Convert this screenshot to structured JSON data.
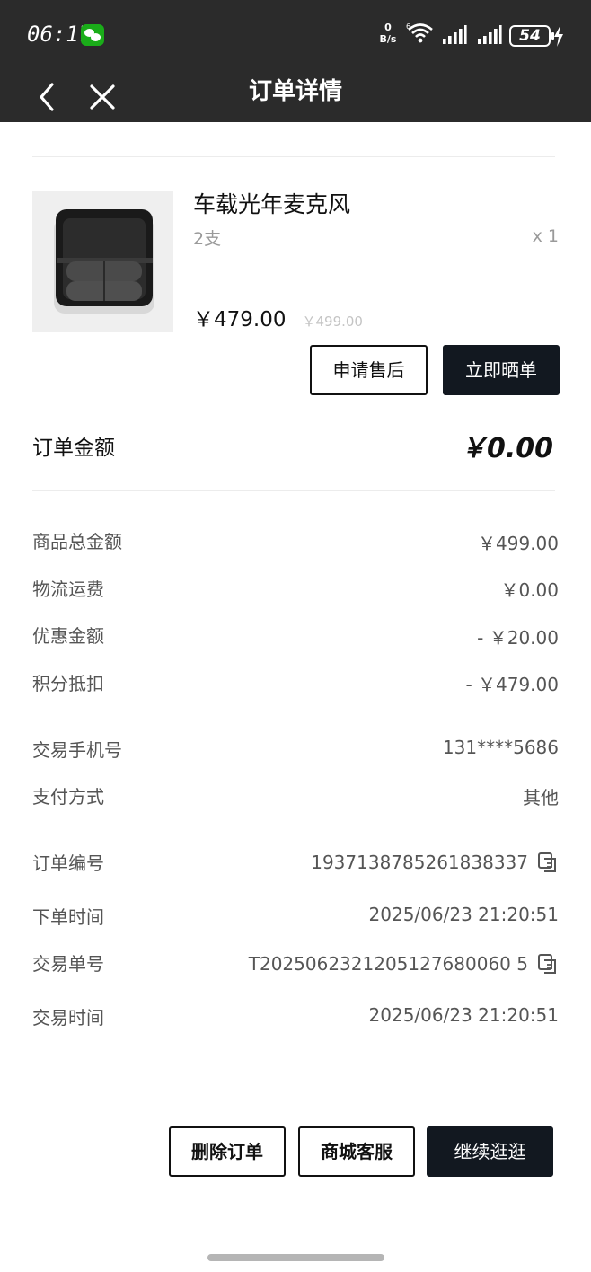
{
  "status_bar": {
    "time": "06:17",
    "net_speed_value": "0",
    "net_speed_unit": "B/s",
    "battery": "54"
  },
  "nav": {
    "title": "订单详情"
  },
  "product": {
    "name": "车载光年麦克风",
    "spec": "2支",
    "quantity": "x 1",
    "price": "￥479.00",
    "original_price": "￥499.00"
  },
  "actions": {
    "after_sale": "申请售后",
    "share": "立即晒单"
  },
  "order_amount": {
    "label": "订单金额",
    "value": "￥0.00"
  },
  "summary": [
    {
      "label": "商品总金额",
      "value": "￥499.00"
    },
    {
      "label": "物流运费",
      "value": "￥0.00"
    },
    {
      "label": "优惠金额",
      "value": "- ￥20.00"
    },
    {
      "label": "积分抵扣",
      "value": "- ￥479.00"
    }
  ],
  "payment": [
    {
      "label": "交易手机号",
      "value": "131****5686"
    },
    {
      "label": "支付方式",
      "value": "其他"
    }
  ],
  "order_info": [
    {
      "label": "订单编号",
      "value": "1937138785261838337",
      "copyable": true
    },
    {
      "label": "下单时间",
      "value": "2025/06/23 21:20:51",
      "copyable": false
    },
    {
      "label": "交易单号",
      "value": "T2025062321205127680060 5",
      "copyable": true
    },
    {
      "label": "交易时间",
      "value": "2025/06/23 21:20:51",
      "copyable": false
    }
  ],
  "footer": {
    "delete": "删除订单",
    "service": "商城客服",
    "continue": "继续逛逛"
  },
  "colors": {
    "header_bg": "#2b2b2b",
    "dark_button": "#121820",
    "wechat_green": "#1aad19"
  },
  "icons": [
    "wechat-icon",
    "wifi-icon",
    "signal-icon",
    "battery-icon",
    "charging-icon",
    "back-icon",
    "close-icon",
    "copy-icon"
  ]
}
